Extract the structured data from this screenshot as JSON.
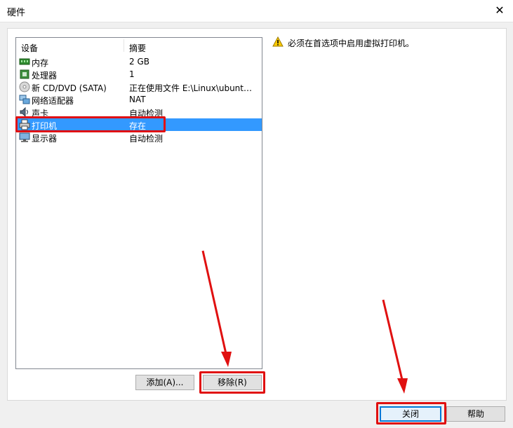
{
  "window": {
    "title": "硬件",
    "close_glyph": "✕"
  },
  "device_list": {
    "headers": {
      "device": "设备",
      "summary": "摘要"
    },
    "rows": [
      {
        "name": "内存",
        "summary": "2 GB",
        "icon": "memory-icon"
      },
      {
        "name": "处理器",
        "summary": "1",
        "icon": "cpu-icon"
      },
      {
        "name": "新 CD/DVD (SATA)",
        "summary": "正在使用文件 E:\\Linux\\ubuntu...",
        "icon": "cd-dvd-icon"
      },
      {
        "name": "网络适配器",
        "summary": "NAT",
        "icon": "network-adapter-icon"
      },
      {
        "name": "声卡",
        "summary": "自动检测",
        "icon": "sound-card-icon"
      },
      {
        "name": "打印机",
        "summary": "存在",
        "icon": "printer-icon",
        "selected": true
      },
      {
        "name": "显示器",
        "summary": "自动检测",
        "icon": "monitor-icon"
      }
    ]
  },
  "details": {
    "warning": "必须在首选项中启用虚拟打印机。",
    "icon": "warning-icon"
  },
  "buttons": {
    "add": "添加(A)...",
    "remove": "移除(R)",
    "close": "关闭",
    "help": "帮助"
  },
  "colors": {
    "selection": "#3399ff",
    "annotation": "#e01010"
  }
}
